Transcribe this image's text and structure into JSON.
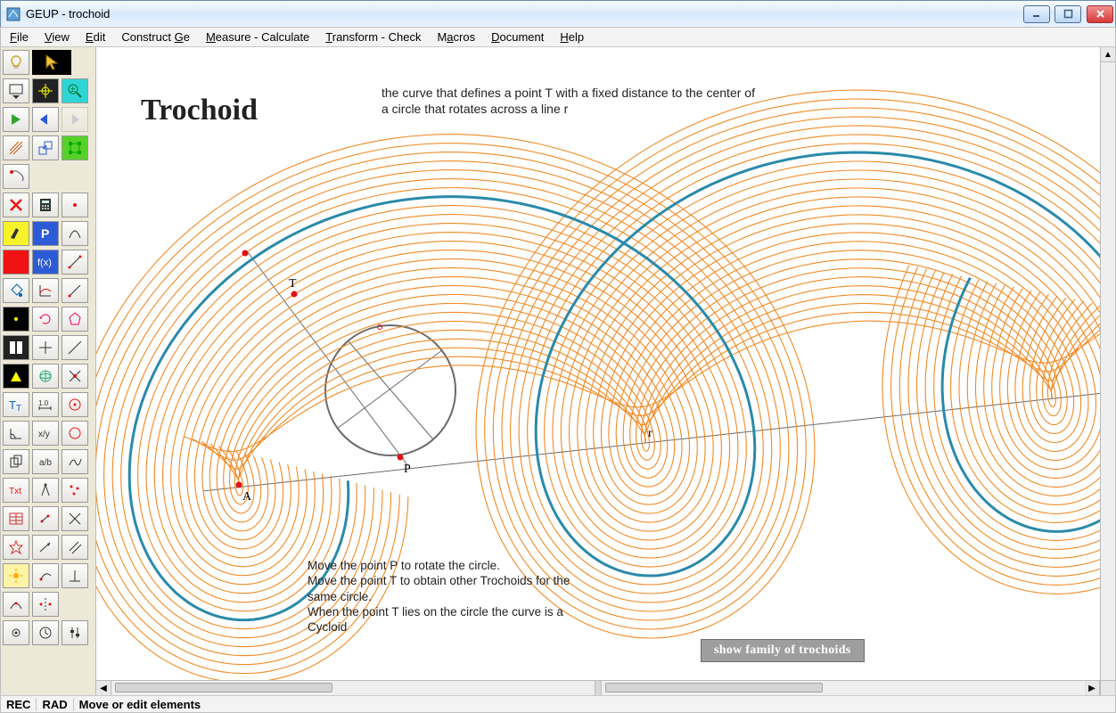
{
  "title": "GEUP - trochoid",
  "menu": [
    "File",
    "View",
    "Edit",
    "Construct Ge",
    "Measure - Calculate",
    "Transform - Check",
    "Macros",
    "Document",
    "Help"
  ],
  "menu_accel": [
    "F",
    "V",
    "E",
    "G",
    "M",
    "T",
    "a",
    "D",
    "H"
  ],
  "canvas": {
    "title": "Trochoid",
    "description": "the curve that defines a point T with a fixed distance to the center of a circle that rotates across a line r",
    "help1": "Move the point P to rotate the circle.",
    "help2": "Move the point T to obtain other Trochoids for the same circle.",
    "help3": "When the point T lies on the circle the curve is a Cycloid",
    "labels": {
      "T": "T",
      "A": "A",
      "P": "P",
      "r": "r"
    },
    "button": "show family of trochoids"
  },
  "colors": {
    "orange": "#f08a24",
    "blue": "#2a8aa9",
    "gray": "#6a6a6a",
    "pointRed": "#e11313"
  },
  "status": {
    "rec": "REC",
    "rad": "RAD",
    "hint": "Move or edit elements"
  }
}
